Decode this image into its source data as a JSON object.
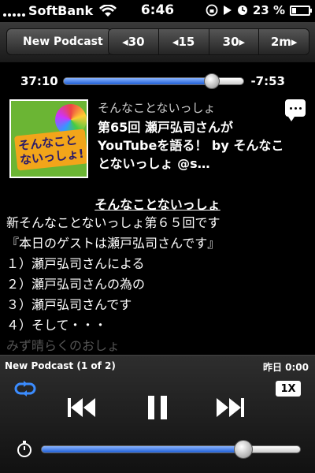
{
  "status_bar": {
    "carrier": "SoftBank",
    "time": "6:46",
    "battery": "23 %",
    "battery_level": 0.23
  },
  "nav": {
    "back_label": "New Podcast",
    "seek_buttons": [
      "◂30",
      "◂15",
      "30▸",
      "2m▸"
    ]
  },
  "progress": {
    "elapsed": "37:10",
    "remaining": "-7:53",
    "fraction": 0.82
  },
  "episode": {
    "podcast_name": "そんなことないっしょ",
    "title": "第65回 瀬戸弘司さんがYouTubeを語る！ by そんなことないっしょ @s…",
    "artwork_text": [
      "そんなこと",
      "ないっしょ!"
    ]
  },
  "description": {
    "heading": "そんなことないっしょ",
    "lines": [
      "新そんなことないっしょ第６５回です",
      "『本日のゲストは瀬戸弘司さんです』",
      "１）瀬戸弘司さんによる",
      "２）瀬戸弘司さんの為の",
      "３）瀬戸弘司さんです",
      "４）そして・・・",
      "みず晴らくのおしょ"
    ]
  },
  "player": {
    "track_info": "New Podcast (1 of 2)",
    "track_date": "昨日 0:00",
    "speed": "1X",
    "volume": 0.78,
    "accent": "#1f5fd6"
  }
}
